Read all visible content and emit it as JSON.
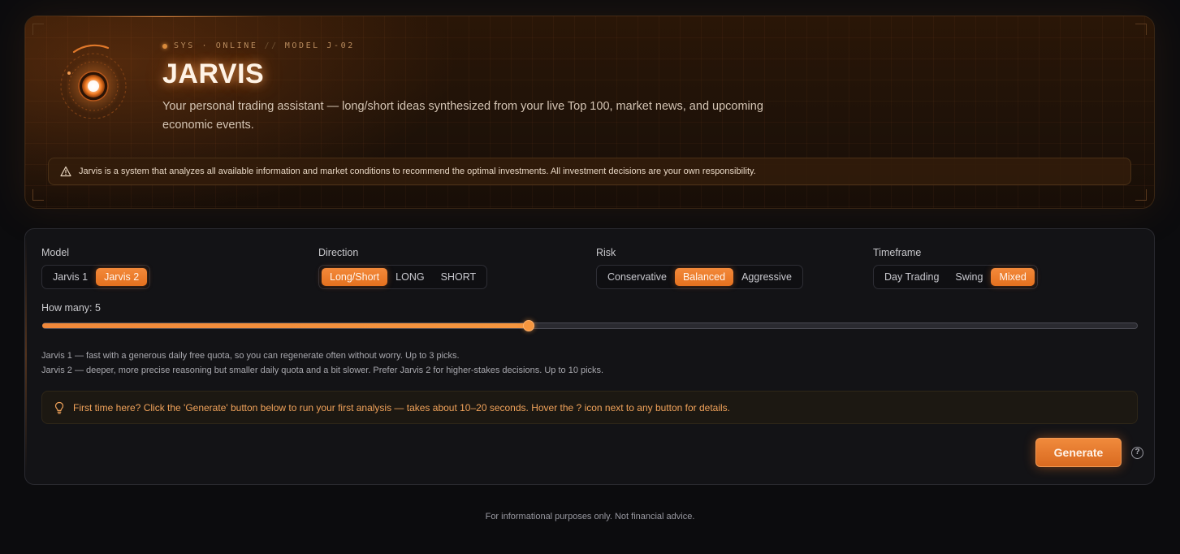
{
  "hero": {
    "status": "SYS · ONLINE",
    "separator": "//",
    "model_tag": "MODEL J-02",
    "title": "JARVIS",
    "description": "Your personal trading assistant — long/short ideas synthesized from your live Top 100, market news, and upcoming economic events.",
    "warning": "Jarvis is a system that analyzes all available information and market conditions to recommend the optimal investments. All investment decisions are your own responsibility.",
    "warning_icon": "warning-triangle-icon",
    "orb_icon": "reactor-orb-icon"
  },
  "controls": {
    "model": {
      "label": "Model",
      "options": [
        "Jarvis 1",
        "Jarvis 2"
      ],
      "selected": "Jarvis 2"
    },
    "direction": {
      "label": "Direction",
      "options": [
        "Long/Short",
        "LONG",
        "SHORT"
      ],
      "selected": "Long/Short"
    },
    "risk": {
      "label": "Risk",
      "options": [
        "Conservative",
        "Balanced",
        "Aggressive"
      ],
      "selected": "Balanced"
    },
    "timeframe": {
      "label": "Timeframe",
      "options": [
        "Day Trading",
        "Swing",
        "Mixed"
      ],
      "selected": "Mixed"
    },
    "how_many": {
      "label": "How many: 5",
      "value": 5,
      "min": 1,
      "max": 10
    },
    "notes": [
      "Jarvis 1 — fast with a generous daily free quota, so you can regenerate often without worry. Up to 3 picks.",
      "Jarvis 2 — deeper, more precise reasoning but smaller daily quota and a bit slower. Prefer Jarvis 2 for higher-stakes decisions. Up to 10 picks."
    ],
    "tip": "First time here? Click the 'Generate' button below to run your first analysis — takes about 10–20 seconds. Hover the ? icon next to any button for details.",
    "tip_icon": "lightbulb-icon",
    "generate_label": "Generate",
    "help_label": "?"
  },
  "footer": {
    "text": "For informational purposes only. Not financial advice."
  },
  "colors": {
    "accent": "#f0883a",
    "background": "#0c0c0e",
    "panel": "#131316",
    "hero": "#1f1208"
  }
}
